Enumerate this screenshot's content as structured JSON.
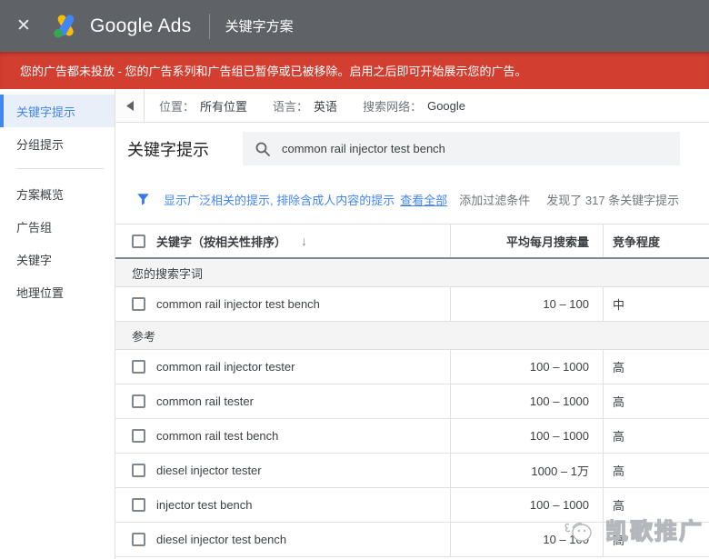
{
  "topbar": {
    "close": "✕",
    "brand": "Google Ads",
    "page": "关键字方案"
  },
  "alert": {
    "text": "您的广告都未投放 - 您的广告系列和广告组已暂停或已被移除。启用之后即可开始展示您的广告。"
  },
  "sidebar": {
    "items": [
      {
        "label": "关键字提示"
      },
      {
        "label": "分组提示"
      },
      {
        "label": "方案概览"
      },
      {
        "label": "广告组"
      },
      {
        "label": "关键字"
      },
      {
        "label": "地理位置"
      }
    ]
  },
  "toolbar": {
    "location_label": "位置：",
    "location_value": "所有位置",
    "language_label": "语言：",
    "language_value": "英语",
    "network_label": "搜索网络：",
    "network_value": "Google"
  },
  "search": {
    "heading": "关键字提示",
    "query": "common rail injector test bench"
  },
  "filterbar": {
    "hint": "显示广泛相关的提示, 排除含成人内容的提示",
    "view_all": "查看全部",
    "add_filter": "添加过滤条件",
    "result_count": "发现了 317 条关键字提示"
  },
  "table": {
    "header": {
      "keyword": "关键字（按相关性排序）",
      "sort_icon": "↓",
      "volume": "平均每月搜索量",
      "competition": "竞争程度"
    },
    "sections": [
      {
        "title": "您的搜索字词",
        "rows": [
          {
            "keyword": "common rail injector test bench",
            "volume": "10 – 100",
            "competition": "中"
          }
        ]
      },
      {
        "title": "参考",
        "rows": [
          {
            "keyword": "common rail injector tester",
            "volume": "100 – 1000",
            "competition": "高"
          },
          {
            "keyword": "common rail tester",
            "volume": "100 – 1000",
            "competition": "高"
          },
          {
            "keyword": "common rail test bench",
            "volume": "100 – 1000",
            "competition": "高"
          },
          {
            "keyword": "diesel injector tester",
            "volume": "1000 – 1万",
            "competition": "高"
          },
          {
            "keyword": "injector test bench",
            "volume": "100 – 1000",
            "competition": "高"
          },
          {
            "keyword": "diesel injector test bench",
            "volume": "10 – 100",
            "competition": "高"
          }
        ]
      }
    ]
  },
  "watermark": {
    "text": "凯歌推广"
  },
  "colors": {
    "accent_blue": "#4285f4",
    "alert_red": "#d23f31",
    "topbar_gray": "#5f6368"
  }
}
